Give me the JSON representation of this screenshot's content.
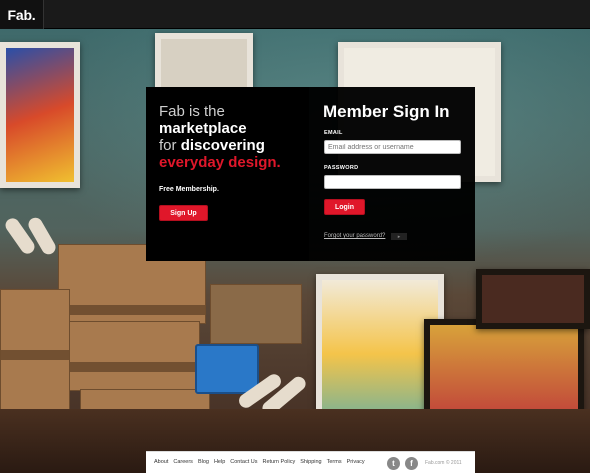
{
  "brand": {
    "logo_text": "Fab",
    "logo_dot": "."
  },
  "hero": {
    "line1_light": "Fab is the",
    "line2_bold": "marketplace",
    "line3_light": "for ",
    "line3_bold": "discovering",
    "line4_red": "everyday design.",
    "free_text": "Free Membership.",
    "signup_label": "Sign Up"
  },
  "signin": {
    "title": "Member Sign In",
    "email_label": "EMAIL",
    "email_placeholder": "Email address or username",
    "password_label": "PASSWORD",
    "login_label": "Login",
    "forgot_label": "Forgot your password?"
  },
  "footer": {
    "links": [
      "About",
      "Careers",
      "Blog",
      "Help",
      "Contact Us",
      "Return Policy",
      "Shipping",
      "Terms",
      "Privacy"
    ],
    "copyright": "Fab.com © 2011"
  },
  "colors": {
    "accent": "#e0172a",
    "topbar": "#1a1a1a"
  },
  "icons": [
    "twitter-icon",
    "facebook-icon"
  ]
}
